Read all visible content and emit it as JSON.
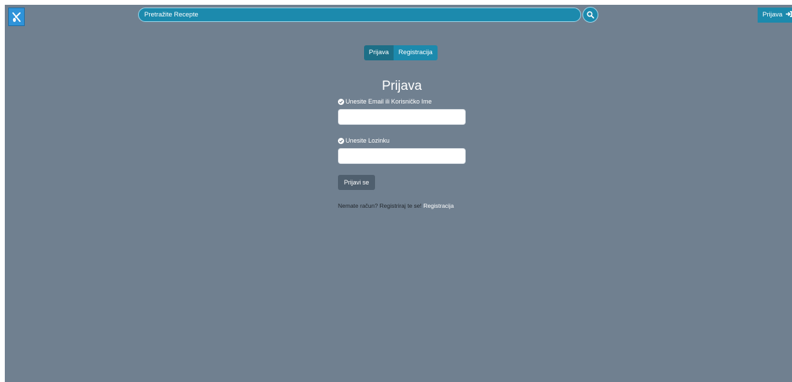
{
  "header": {
    "logo_icon": "utensils-book-icon",
    "search_placeholder": "Pretražite Recepte",
    "search_button_icon": "search-icon",
    "login_label": "Prijava",
    "login_icon": "sign-in-icon"
  },
  "tabs": [
    {
      "label": "Prijava",
      "active": true
    },
    {
      "label": "Registracija",
      "active": false
    }
  ],
  "form": {
    "title": "Prijava",
    "username_label": "Unesite Email ili Korisničko Ime",
    "username_value": "",
    "password_label": "Unesite Lozinku",
    "password_value": "",
    "label_icon": "check-circle-icon",
    "submit_label": "Prijavi se",
    "register_prompt": "Nemate račun? Registriraj te se!",
    "register_link": "Registracija"
  },
  "colors": {
    "background": "#708090",
    "accent": "#1c8aad",
    "active_tab": "#1d6f87",
    "submit_button": "#4f5f6e"
  }
}
